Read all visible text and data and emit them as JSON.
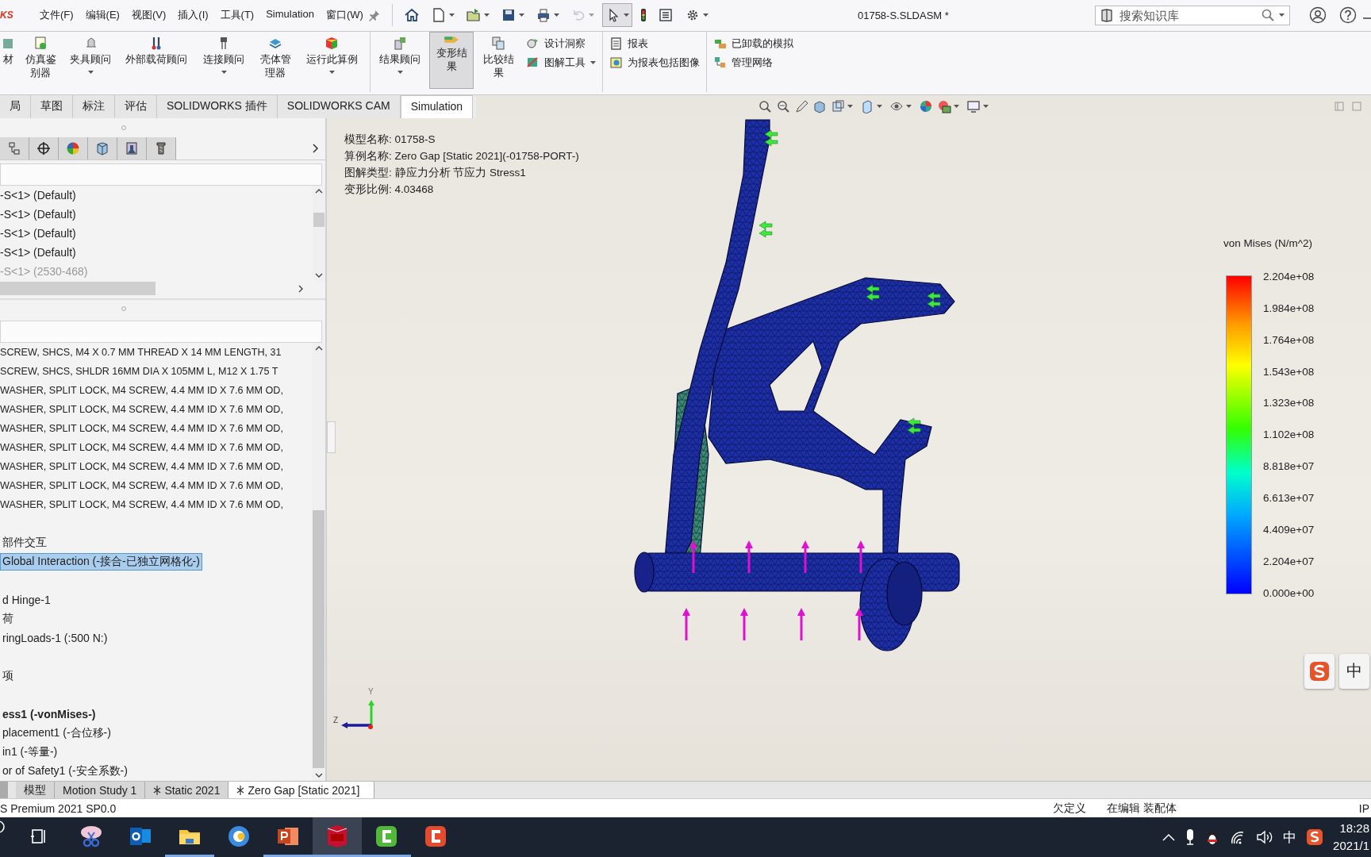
{
  "menu_bar": {
    "logo": "KS",
    "items": [
      "文件(F)",
      "编辑(E)",
      "视图(V)",
      "插入(I)",
      "工具(T)",
      "Simulation",
      "窗口(W)"
    ],
    "title": "01758-S.SLDASM *",
    "search": {
      "placeholder": "搜索知识库"
    }
  },
  "quick_toolbar": [
    {
      "caret": false,
      "disabled": false,
      "selected": false
    },
    {
      "caret": true,
      "disabled": false,
      "selected": false
    },
    {
      "caret": true,
      "disabled": false,
      "selected": false
    },
    {
      "caret": true,
      "disabled": false,
      "selected": false
    },
    {
      "caret": true,
      "disabled": false,
      "selected": false
    },
    {
      "caret": true,
      "disabled": true,
      "selected": false
    },
    {
      "caret": true,
      "disabled": false,
      "selected": true
    },
    {
      "caret": false,
      "disabled": false,
      "selected": false
    },
    {
      "caret": false,
      "disabled": false,
      "selected": false
    },
    {
      "caret": true,
      "disabled": false,
      "selected": false
    }
  ],
  "ribbon": [
    {
      "kind": "large",
      "label": "材",
      "caret": false,
      "selected": false
    },
    {
      "kind": "large",
      "label": "仿真鉴别器",
      "caret": false,
      "selected": false
    },
    {
      "kind": "large",
      "label": "夹具顾问",
      "caret": true,
      "selected": false
    },
    {
      "kind": "large",
      "label": "外部载荷顾问",
      "caret": false,
      "selected": false
    },
    {
      "kind": "large",
      "label": "连接顾问",
      "caret": true,
      "selected": false
    },
    {
      "kind": "large",
      "label": "壳体管理器",
      "caret": false,
      "selected": false
    },
    {
      "kind": "large",
      "label": "运行此算例",
      "caret": true,
      "selected": false
    },
    {
      "kind": "separator"
    },
    {
      "kind": "large",
      "label": "结果顾问",
      "caret": true,
      "selected": false
    },
    {
      "kind": "large",
      "label": "变形结果",
      "caret": false,
      "selected": true
    },
    {
      "kind": "large",
      "label": "比较结果",
      "caret": false,
      "selected": false
    },
    {
      "kind": "small",
      "rows": [
        {
          "label": "设计洞察",
          "caret": false
        },
        {
          "label": "图解工具",
          "caret": true
        }
      ]
    },
    {
      "kind": "separator"
    },
    {
      "kind": "small",
      "rows": [
        {
          "label": "报表",
          "caret": false
        },
        {
          "label": "为报表包括图像",
          "caret": false
        }
      ]
    },
    {
      "kind": "separator"
    },
    {
      "kind": "small",
      "rows": [
        {
          "label": "已卸载的模拟",
          "caret": false
        },
        {
          "label": "管理网络",
          "caret": false
        }
      ]
    }
  ],
  "command_tabs": [
    {
      "label": "局",
      "selected": false
    },
    {
      "label": "草图",
      "selected": false
    },
    {
      "label": "标注",
      "selected": false
    },
    {
      "label": "评估",
      "selected": false
    },
    {
      "label": "SOLIDWORKS 插件",
      "selected": false
    },
    {
      "label": "SOLIDWORKS CAM",
      "selected": false
    },
    {
      "label": "Simulation",
      "selected": true
    }
  ],
  "panel": {
    "tree": [
      {
        "text": "-S<1> (Default)",
        "suppressed": false
      },
      {
        "text": "-S<1> (Default)",
        "suppressed": false
      },
      {
        "text": "-S<1> (Default)",
        "suppressed": false
      },
      {
        "text": "-S<1> (Default)",
        "suppressed": false
      },
      {
        "text": "-S<1> (2530-468)",
        "suppressed": true
      }
    ],
    "parts": [
      "SCREW, SHCS, M4 X 0.7 MM THREAD X 14 MM LENGTH, 31",
      "SCREW, SHCS, SHLDR 16MM DIA X 105MM L, M12 X 1.75 T",
      "WASHER, SPLIT LOCK, M4 SCREW, 4.4 MM ID X 7.6 MM OD,",
      "WASHER, SPLIT LOCK, M4 SCREW, 4.4 MM ID X 7.6 MM OD,",
      "WASHER, SPLIT LOCK, M4 SCREW, 4.4 MM ID X 7.6 MM OD,",
      "WASHER, SPLIT LOCK, M4 SCREW, 4.4 MM ID X 7.6 MM OD,",
      "WASHER, SPLIT LOCK, M4 SCREW, 4.4 MM ID X 7.6 MM OD,",
      "WASHER, SPLIT LOCK, M4 SCREW, 4.4 MM ID X 7.6 MM OD,",
      "WASHER, SPLIT LOCK, M4 SCREW, 4.4 MM ID X 7.6 MM OD,"
    ],
    "study": [
      {
        "items": [
          {
            "text": "部件交互",
            "selected": false,
            "active": false
          },
          {
            "text": "Global Interaction (-接合-已独立网格化-)",
            "selected": true,
            "active": false
          }
        ]
      },
      {
        "items": [
          {
            "text": "d Hinge-1",
            "selected": false,
            "active": false
          },
          {
            "text": "荷",
            "selected": false,
            "active": false
          },
          {
            "text": "ringLoads-1 (:500 N:)",
            "selected": false,
            "active": false
          }
        ]
      },
      {
        "items": [
          {
            "text": "项",
            "selected": false,
            "active": false
          }
        ]
      },
      {
        "items": [
          {
            "text": "ess1 (-vonMises-)",
            "selected": false,
            "active": true
          },
          {
            "text": "placement1 (-合位移-)",
            "selected": false,
            "active": false
          },
          {
            "text": "in1 (-等量-)",
            "selected": false,
            "active": false
          },
          {
            "text": "or of Safety1 (-安全系数-)",
            "selected": false,
            "active": false
          }
        ]
      }
    ]
  },
  "viewport": {
    "info": [
      "模型名称: 01758-S",
      "算例名称: Zero Gap [Static 2021](-01758-PORT-)",
      "图解类型: 静应力分析 节应力 Stress1",
      "变形比例: 4.03468"
    ],
    "legend": {
      "title": "von Mises (N/m^2)",
      "labels": [
        "2.204e+08",
        "1.984e+08",
        "1.764e+08",
        "1.543e+08",
        "1.323e+08",
        "1.102e+08",
        "8.818e+07",
        "6.613e+07",
        "4.409e+07",
        "2.204e+07",
        "0.000e+00"
      ]
    },
    "triad": {
      "y": "Y",
      "z": "Z"
    },
    "ime": "中"
  },
  "bottom_tabs": [
    {
      "label": "模型",
      "selected": false
    },
    {
      "label": "Motion Study 1",
      "selected": false
    },
    {
      "label": "Static 2021",
      "selected": false
    },
    {
      "label": "Zero Gap [Static 2021]",
      "selected": true
    }
  ],
  "status_bar": {
    "product": "S Premium 2021 SP0.0",
    "state": "欠定义",
    "mode": "在编辑 装配体",
    "units": "IP"
  },
  "taskbar": {
    "apps": [
      {
        "running": false,
        "selected": false
      },
      {
        "running": false,
        "selected": false
      },
      {
        "running": true,
        "selected": false
      },
      {
        "running": false,
        "selected": false
      },
      {
        "running": true,
        "selected": false
      },
      {
        "running": true,
        "selected": true
      },
      {
        "running": true,
        "selected": false
      },
      {
        "running": false,
        "selected": false
      }
    ],
    "tray": {
      "ime": "中",
      "time": "18:28",
      "date": "2021/1"
    }
  }
}
